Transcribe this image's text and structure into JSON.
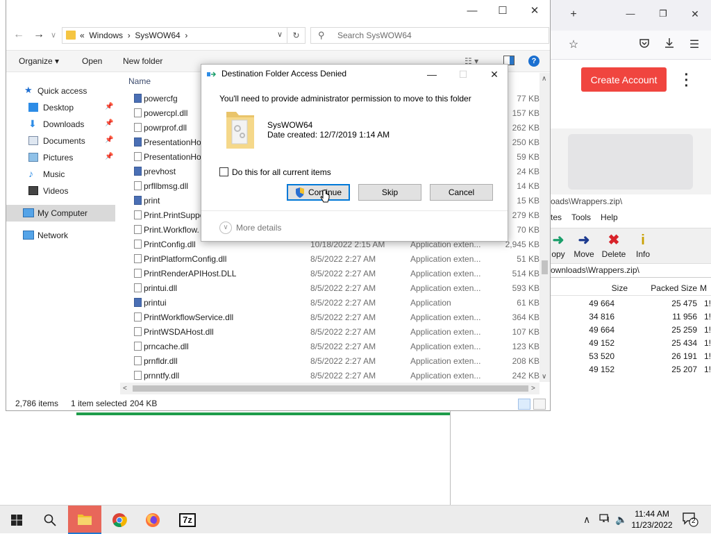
{
  "browser": {
    "new_tab_symbol": "+",
    "minimize_symbol": "—",
    "maximize_symbol": "❐",
    "close_symbol": "✕",
    "create_account_label": "Create Account",
    "accent": "#f0453f"
  },
  "sevenzip": {
    "title": "oads\\Wrappers.zip\\",
    "menu": [
      "tes",
      "Tools",
      "Help"
    ],
    "tools": [
      {
        "label": "opy",
        "icon": "copy-arrow-icon"
      },
      {
        "label": "Move",
        "icon": "move-arrow-icon"
      },
      {
        "label": "Delete",
        "icon": "delete-x-icon"
      },
      {
        "label": "Info",
        "icon": "info-icon"
      }
    ],
    "address": "ownloads\\Wrappers.zip\\",
    "columns": {
      "size": "Size",
      "packed": "Packed Size",
      "m": "M"
    },
    "rows": [
      {
        "size": "49 664",
        "packed": "25 475",
        "m": "1!"
      },
      {
        "size": "34 816",
        "packed": "11 956",
        "m": "1!"
      },
      {
        "size": "49 664",
        "packed": "25 259",
        "m": "1!"
      },
      {
        "size": "49 152",
        "packed": "25 434",
        "m": "1!"
      },
      {
        "size": "53 520",
        "packed": "26 191",
        "m": "1!"
      },
      {
        "size": "49 152",
        "packed": "25 207",
        "m": "1!"
      }
    ]
  },
  "explorer": {
    "address": {
      "overflow": "«",
      "crumb1": "Windows",
      "sep": "›",
      "crumb2": "SysWOW64",
      "sep2": "›"
    },
    "search_placeholder": "Search SysWOW64",
    "commands": {
      "organize": "Organize ▾",
      "open": "Open",
      "new_folder": "New folder",
      "help": "?"
    },
    "nav": [
      {
        "label": "Quick access",
        "icon": "star-icon",
        "pinned": false
      },
      {
        "label": "Desktop",
        "icon": "desktop-icon",
        "pinned": true
      },
      {
        "label": "Downloads",
        "icon": "download-icon",
        "pinned": true
      },
      {
        "label": "Documents",
        "icon": "documents-icon",
        "pinned": true
      },
      {
        "label": "Pictures",
        "icon": "pictures-icon",
        "pinned": true
      },
      {
        "label": "Music",
        "icon": "music-icon",
        "pinned": false
      },
      {
        "label": "Videos",
        "icon": "videos-icon",
        "pinned": false
      },
      {
        "label": "My Computer",
        "icon": "computer-icon",
        "pinned": false
      },
      {
        "label": "Network",
        "icon": "network-icon",
        "pinned": false
      }
    ],
    "column_name": "Name",
    "files": [
      {
        "name": "powercfg",
        "date": "",
        "type": "",
        "size": "77 KB",
        "kind": "app"
      },
      {
        "name": "powercpl.dll",
        "date": "",
        "type": "",
        "size": "157 KB",
        "kind": "dll"
      },
      {
        "name": "powrprof.dll",
        "date": "",
        "type": "",
        "size": "262 KB",
        "kind": "dll"
      },
      {
        "name": "PresentationHo",
        "date": "",
        "type": "",
        "size": "250 KB",
        "kind": "app"
      },
      {
        "name": "PresentationHo",
        "date": "",
        "type": "",
        "size": "59 KB",
        "kind": "dll"
      },
      {
        "name": "prevhost",
        "date": "",
        "type": "",
        "size": "24 KB",
        "kind": "app"
      },
      {
        "name": "prfllbmsg.dll",
        "date": "",
        "type": "",
        "size": "14 KB",
        "kind": "dll"
      },
      {
        "name": "print",
        "date": "",
        "type": "",
        "size": "15 KB",
        "kind": "app"
      },
      {
        "name": "Print.PrintSuppo",
        "date": "",
        "type": "",
        "size": "279 KB",
        "kind": "dll"
      },
      {
        "name": "Print.Workflow.",
        "date": "",
        "type": "",
        "size": "70 KB",
        "kind": "dll"
      },
      {
        "name": "PrintConfig.dll",
        "date": "10/18/2022 2:15 AM",
        "type": "Application exten...",
        "size": "2,945 KB",
        "kind": "dll"
      },
      {
        "name": "PrintPlatformConfig.dll",
        "date": "8/5/2022 2:27 AM",
        "type": "Application exten...",
        "size": "51 KB",
        "kind": "dll"
      },
      {
        "name": "PrintRenderAPIHost.DLL",
        "date": "8/5/2022 2:27 AM",
        "type": "Application exten...",
        "size": "514 KB",
        "kind": "dll"
      },
      {
        "name": "printui.dll",
        "date": "8/5/2022 2:27 AM",
        "type": "Application exten...",
        "size": "593 KB",
        "kind": "dll"
      },
      {
        "name": "printui",
        "date": "8/5/2022 2:27 AM",
        "type": "Application",
        "size": "61 KB",
        "kind": "app"
      },
      {
        "name": "PrintWorkflowService.dll",
        "date": "8/5/2022 2:27 AM",
        "type": "Application exten...",
        "size": "364 KB",
        "kind": "dll"
      },
      {
        "name": "PrintWSDAHost.dll",
        "date": "8/5/2022 2:27 AM",
        "type": "Application exten...",
        "size": "107 KB",
        "kind": "dll"
      },
      {
        "name": "prncache.dll",
        "date": "8/5/2022 2:27 AM",
        "type": "Application exten...",
        "size": "123 KB",
        "kind": "dll"
      },
      {
        "name": "prnfldr.dll",
        "date": "8/5/2022 2:27 AM",
        "type": "Application exten...",
        "size": "208 KB",
        "kind": "dll"
      },
      {
        "name": "prnntfy.dll",
        "date": "8/5/2022 2:27 AM",
        "type": "Application exten...",
        "size": "242 KB",
        "kind": "dll"
      }
    ],
    "status": {
      "count": "2,786 items",
      "selection": "1 item selected",
      "size": "204 KB"
    }
  },
  "dialog": {
    "title": "Destination Folder Access Denied",
    "message": "You'll need to provide administrator permission to move to this folder",
    "folder_name": "SysWOW64",
    "date_created": "Date created: 12/7/2019 1:14 AM",
    "checkbox_label": "Do this for all current items",
    "checkbox_checked": false,
    "continue": "Continue",
    "skip": "Skip",
    "cancel": "Cancel",
    "more_details": "More details"
  },
  "taskbar": {
    "time": "11:44 AM",
    "date": "11/23/2022",
    "notification_count": "2",
    "apps": [
      "start-icon",
      "search-icon",
      "file-explorer-icon",
      "chrome-icon",
      "firefox-icon",
      "7zip-icon"
    ],
    "sevenzip_label": "7z"
  }
}
